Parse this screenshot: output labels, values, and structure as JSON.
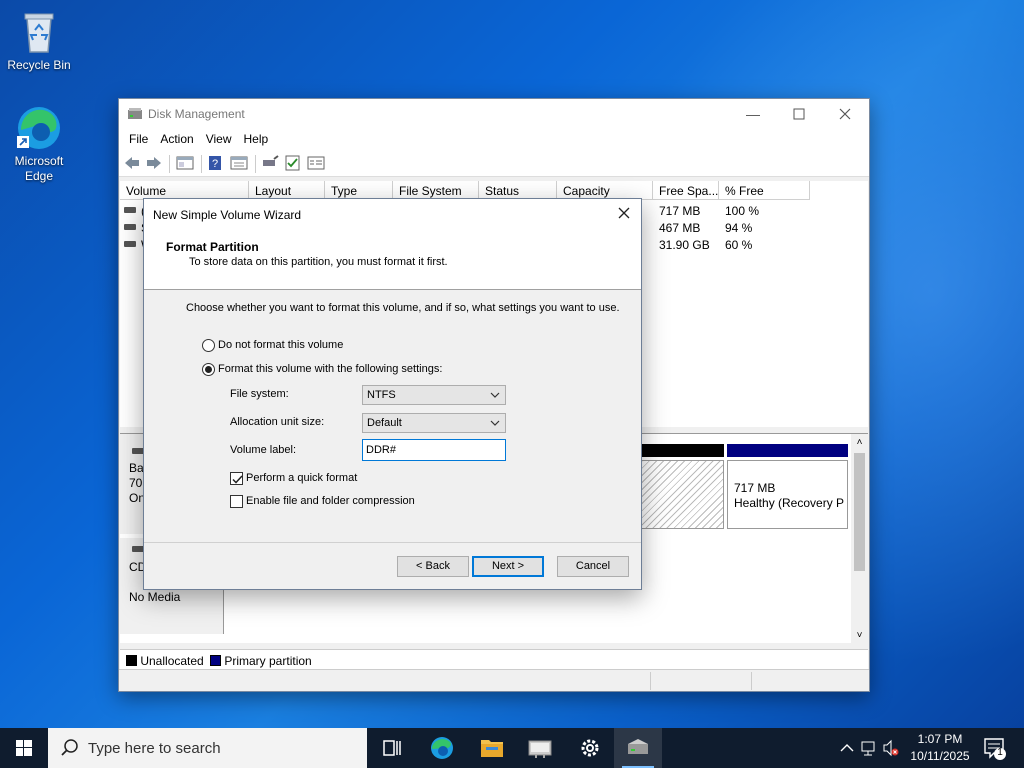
{
  "desktop": {
    "icons": [
      {
        "label": "Recycle Bin",
        "icon": "recycle-bin-icon"
      },
      {
        "label": "Microsoft Edge",
        "icon": "edge-icon"
      }
    ]
  },
  "disk_management": {
    "title": "Disk Management",
    "menu": [
      "File",
      "Action",
      "View",
      "Help"
    ],
    "columns": [
      "Volume",
      "Layout",
      "Type",
      "File System",
      "Status",
      "Capacity",
      "Free Spa...",
      "% Free"
    ],
    "rows": [
      {
        "volume": "(",
        "free": "717 MB",
        "pct_free": "100 %"
      },
      {
        "volume": "S",
        "free": "467 MB",
        "pct_free": "94 %"
      },
      {
        "volume": "W",
        "free": "31.90 GB",
        "pct_free": "60 %"
      }
    ],
    "disks": [
      {
        "label_lines": [
          "Ba",
          "70.",
          "On"
        ]
      },
      {
        "label_lines": [
          "CD",
          "",
          "No Media"
        ]
      }
    ],
    "recovery_partition": {
      "size": "717 MB",
      "status": "Healthy (Recovery Pa"
    },
    "legend": [
      {
        "label": "Unallocated",
        "color": "#000000"
      },
      {
        "label": "Primary partition",
        "color": "#000080"
      }
    ]
  },
  "wizard": {
    "title": "New Simple Volume Wizard",
    "header_title": "Format Partition",
    "header_subtitle": "To store data on this partition, you must format it first.",
    "intro": "Choose whether you want to format this volume, and if so, what settings you want to use.",
    "option_no_format": "Do not format this volume",
    "option_format": "Format this volume with the following settings:",
    "selected_option": "format",
    "file_system_label": "File system:",
    "file_system_value": "NTFS",
    "allocation_label": "Allocation unit size:",
    "allocation_value": "Default",
    "volume_label_label": "Volume label:",
    "volume_label_value": "DDR#",
    "quick_format_label": "Perform a quick format",
    "quick_format_checked": true,
    "compression_label": "Enable file and folder compression",
    "compression_checked": false,
    "back_label": "< Back",
    "next_label": "Next >",
    "cancel_label": "Cancel"
  },
  "taskbar": {
    "search_placeholder": "Type here to search",
    "apps": [
      "task-view-icon",
      "edge-icon",
      "file-explorer-icon",
      "network-app-icon",
      "settings-icon",
      "disk-management-icon"
    ],
    "time": "1:07 PM",
    "date": "10/11/2025",
    "notification_count": "1"
  },
  "colors": {
    "unallocated": "#000000",
    "primary_partition": "#000080",
    "accent": "#0078d7"
  }
}
